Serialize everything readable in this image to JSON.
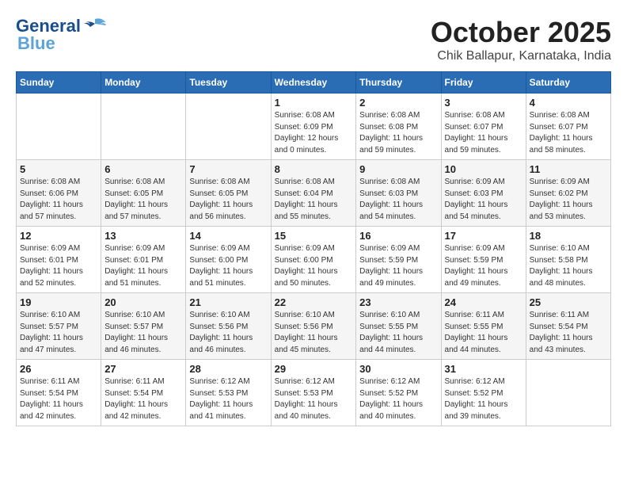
{
  "logo": {
    "line1": "General",
    "line2": "Blue"
  },
  "title": "October 2025",
  "subtitle": "Chik Ballapur, Karnataka, India",
  "days_of_week": [
    "Sunday",
    "Monday",
    "Tuesday",
    "Wednesday",
    "Thursday",
    "Friday",
    "Saturday"
  ],
  "weeks": [
    [
      {
        "day": "",
        "info": ""
      },
      {
        "day": "",
        "info": ""
      },
      {
        "day": "",
        "info": ""
      },
      {
        "day": "1",
        "info": "Sunrise: 6:08 AM\nSunset: 6:09 PM\nDaylight: 12 hours\nand 0 minutes."
      },
      {
        "day": "2",
        "info": "Sunrise: 6:08 AM\nSunset: 6:08 PM\nDaylight: 11 hours\nand 59 minutes."
      },
      {
        "day": "3",
        "info": "Sunrise: 6:08 AM\nSunset: 6:07 PM\nDaylight: 11 hours\nand 59 minutes."
      },
      {
        "day": "4",
        "info": "Sunrise: 6:08 AM\nSunset: 6:07 PM\nDaylight: 11 hours\nand 58 minutes."
      }
    ],
    [
      {
        "day": "5",
        "info": "Sunrise: 6:08 AM\nSunset: 6:06 PM\nDaylight: 11 hours\nand 57 minutes."
      },
      {
        "day": "6",
        "info": "Sunrise: 6:08 AM\nSunset: 6:05 PM\nDaylight: 11 hours\nand 57 minutes."
      },
      {
        "day": "7",
        "info": "Sunrise: 6:08 AM\nSunset: 6:05 PM\nDaylight: 11 hours\nand 56 minutes."
      },
      {
        "day": "8",
        "info": "Sunrise: 6:08 AM\nSunset: 6:04 PM\nDaylight: 11 hours\nand 55 minutes."
      },
      {
        "day": "9",
        "info": "Sunrise: 6:08 AM\nSunset: 6:03 PM\nDaylight: 11 hours\nand 54 minutes."
      },
      {
        "day": "10",
        "info": "Sunrise: 6:09 AM\nSunset: 6:03 PM\nDaylight: 11 hours\nand 54 minutes."
      },
      {
        "day": "11",
        "info": "Sunrise: 6:09 AM\nSunset: 6:02 PM\nDaylight: 11 hours\nand 53 minutes."
      }
    ],
    [
      {
        "day": "12",
        "info": "Sunrise: 6:09 AM\nSunset: 6:01 PM\nDaylight: 11 hours\nand 52 minutes."
      },
      {
        "day": "13",
        "info": "Sunrise: 6:09 AM\nSunset: 6:01 PM\nDaylight: 11 hours\nand 51 minutes."
      },
      {
        "day": "14",
        "info": "Sunrise: 6:09 AM\nSunset: 6:00 PM\nDaylight: 11 hours\nand 51 minutes."
      },
      {
        "day": "15",
        "info": "Sunrise: 6:09 AM\nSunset: 6:00 PM\nDaylight: 11 hours\nand 50 minutes."
      },
      {
        "day": "16",
        "info": "Sunrise: 6:09 AM\nSunset: 5:59 PM\nDaylight: 11 hours\nand 49 minutes."
      },
      {
        "day": "17",
        "info": "Sunrise: 6:09 AM\nSunset: 5:59 PM\nDaylight: 11 hours\nand 49 minutes."
      },
      {
        "day": "18",
        "info": "Sunrise: 6:10 AM\nSunset: 5:58 PM\nDaylight: 11 hours\nand 48 minutes."
      }
    ],
    [
      {
        "day": "19",
        "info": "Sunrise: 6:10 AM\nSunset: 5:57 PM\nDaylight: 11 hours\nand 47 minutes."
      },
      {
        "day": "20",
        "info": "Sunrise: 6:10 AM\nSunset: 5:57 PM\nDaylight: 11 hours\nand 46 minutes."
      },
      {
        "day": "21",
        "info": "Sunrise: 6:10 AM\nSunset: 5:56 PM\nDaylight: 11 hours\nand 46 minutes."
      },
      {
        "day": "22",
        "info": "Sunrise: 6:10 AM\nSunset: 5:56 PM\nDaylight: 11 hours\nand 45 minutes."
      },
      {
        "day": "23",
        "info": "Sunrise: 6:10 AM\nSunset: 5:55 PM\nDaylight: 11 hours\nand 44 minutes."
      },
      {
        "day": "24",
        "info": "Sunrise: 6:11 AM\nSunset: 5:55 PM\nDaylight: 11 hours\nand 44 minutes."
      },
      {
        "day": "25",
        "info": "Sunrise: 6:11 AM\nSunset: 5:54 PM\nDaylight: 11 hours\nand 43 minutes."
      }
    ],
    [
      {
        "day": "26",
        "info": "Sunrise: 6:11 AM\nSunset: 5:54 PM\nDaylight: 11 hours\nand 42 minutes."
      },
      {
        "day": "27",
        "info": "Sunrise: 6:11 AM\nSunset: 5:54 PM\nDaylight: 11 hours\nand 42 minutes."
      },
      {
        "day": "28",
        "info": "Sunrise: 6:12 AM\nSunset: 5:53 PM\nDaylight: 11 hours\nand 41 minutes."
      },
      {
        "day": "29",
        "info": "Sunrise: 6:12 AM\nSunset: 5:53 PM\nDaylight: 11 hours\nand 40 minutes."
      },
      {
        "day": "30",
        "info": "Sunrise: 6:12 AM\nSunset: 5:52 PM\nDaylight: 11 hours\nand 40 minutes."
      },
      {
        "day": "31",
        "info": "Sunrise: 6:12 AM\nSunset: 5:52 PM\nDaylight: 11 hours\nand 39 minutes."
      },
      {
        "day": "",
        "info": ""
      }
    ]
  ]
}
